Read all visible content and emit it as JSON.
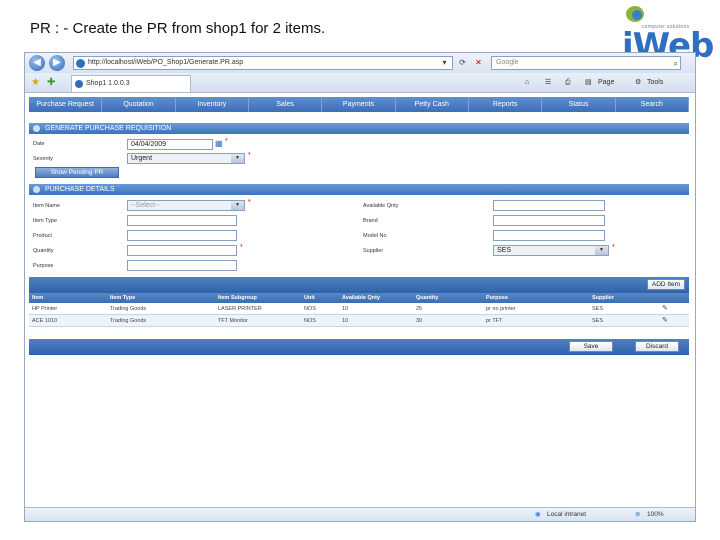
{
  "slide": {
    "title": "PR : - Create the PR from shop1 for 2 items."
  },
  "logo": {
    "word": "iWeb",
    "tagline": "computer solutions"
  },
  "browser": {
    "address": "http://localhost/iWeb/PO_Shop1/Generate.PR.asp",
    "search_placeholder": "Google",
    "tab_title": "Shop1 1.0.0.3",
    "tools": {
      "page": "Page",
      "tools": "Tools"
    },
    "status": {
      "zone": "Local intranet",
      "zoom": "100%"
    }
  },
  "menu": [
    "Purchase Request",
    "Quotation",
    "Inventory",
    "Sales",
    "Payments",
    "Petty Cash",
    "Reports",
    "Status",
    "Search"
  ],
  "generate_section": {
    "title": "GENERATE PURCHASE REQUISITION",
    "date_label": "Date",
    "date_value": "04/04/2009",
    "severity_label": "Severity",
    "severity_value": "Urgent",
    "show_pending_button": "Show Pending PR"
  },
  "details_section": {
    "title": "PURCHASE DETAILS",
    "item_name_label": "Item Name",
    "item_name_value": "--Select--",
    "item_type_label": "Item Type",
    "product_label": "Product",
    "quantity_label": "Quantity",
    "purpose_label": "Purpose",
    "available_qty_label": "Available Qnty",
    "brand_label": "Brand",
    "model_label": "Model No",
    "supplier_label": "Supplier",
    "supplier_value": "SES"
  },
  "add_item_button": "ADD Item",
  "grid": {
    "columns": [
      "Item",
      "Item Type",
      "Item Subgroup",
      "Unit",
      "Available Qnty",
      "Quantity",
      "Purpose",
      "Supplier",
      ""
    ],
    "rows": [
      [
        "HP Printer",
        "Trading Goods",
        "LASER PRINTER",
        "NOS",
        "10",
        "25",
        "pr no printer",
        "SES",
        "✎"
      ],
      [
        "ACE 1010",
        "Trading Goods",
        "TFT Monitor",
        "NOS",
        "10",
        "30",
        "pr TFT",
        "SES",
        "✎"
      ]
    ]
  },
  "footer_buttons": {
    "save": "Save",
    "discard": "Discard"
  },
  "colors": {
    "accent": "#3b6fb7",
    "header": "#5f8fd0"
  }
}
